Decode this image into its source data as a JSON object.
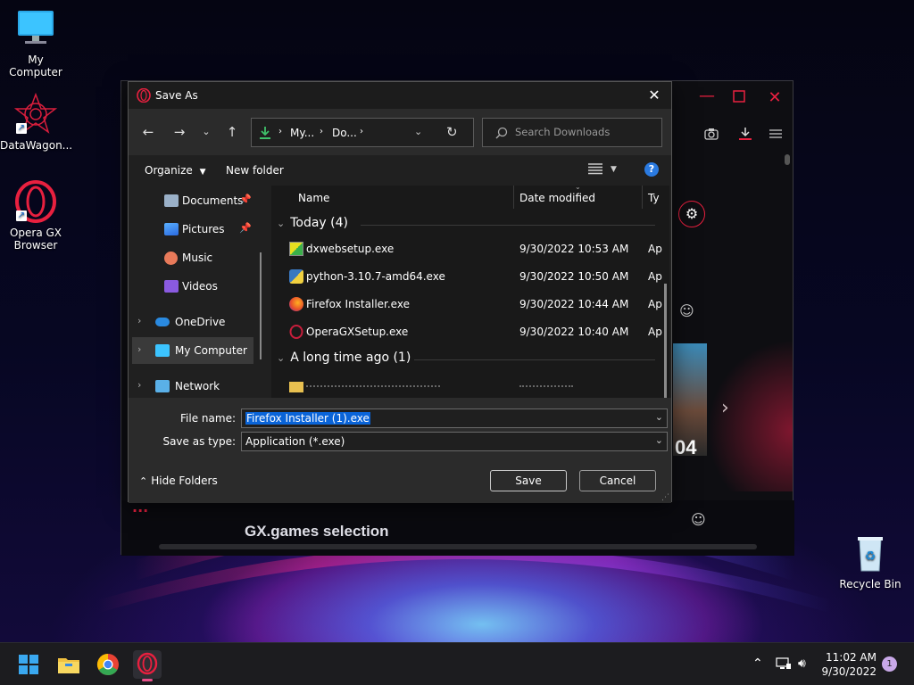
{
  "desktop": {
    "icons": [
      {
        "label": "My Computer"
      },
      {
        "label": "DataWagon..."
      },
      {
        "label": "Opera GX Browser"
      },
      {
        "label": "Recycle Bin"
      }
    ]
  },
  "browser": {
    "carousel_number": "04",
    "section_title": "GX.games selection",
    "menu_dots": "..."
  },
  "dialog": {
    "title": "Save As",
    "address": {
      "seg1": "My...",
      "seg2": "Do..."
    },
    "search_placeholder": "Search Downloads",
    "toolbar": {
      "organize": "Organize",
      "new_folder": "New folder"
    },
    "sidebar": [
      {
        "label": "Documents"
      },
      {
        "label": "Pictures"
      },
      {
        "label": "Music"
      },
      {
        "label": "Videos"
      },
      {
        "label": "OneDrive"
      },
      {
        "label": "My Computer"
      },
      {
        "label": "Network"
      }
    ],
    "columns": {
      "name": "Name",
      "date": "Date modified",
      "type": "Ty"
    },
    "groups": [
      {
        "label": "Today (4)"
      },
      {
        "label": "A long time ago (1)"
      }
    ],
    "files": [
      {
        "name": "dxwebsetup.exe",
        "date": "9/30/2022 10:53 AM",
        "type": "Ap"
      },
      {
        "name": "python-3.10.7-amd64.exe",
        "date": "9/30/2022 10:50 AM",
        "type": "Ap"
      },
      {
        "name": "Firefox Installer.exe",
        "date": "9/30/2022 10:44 AM",
        "type": "Ap"
      },
      {
        "name": "OperaGXSetup.exe",
        "date": "9/30/2022 10:40 AM",
        "type": "Ap"
      }
    ],
    "form": {
      "file_name_label": "File name:",
      "file_name_value": "Firefox Installer (1).exe",
      "save_type_label": "Save as type:",
      "save_type_value": "Application (*.exe)"
    },
    "hide_folders": "Hide Folders",
    "save_label": "Save",
    "cancel_label": "Cancel"
  },
  "taskbar": {
    "time": "11:02 AM",
    "date": "9/30/2022",
    "notification_count": "1"
  },
  "colors": {
    "opera_red": "#e8203f",
    "accent_blue": "#0a64d8"
  }
}
